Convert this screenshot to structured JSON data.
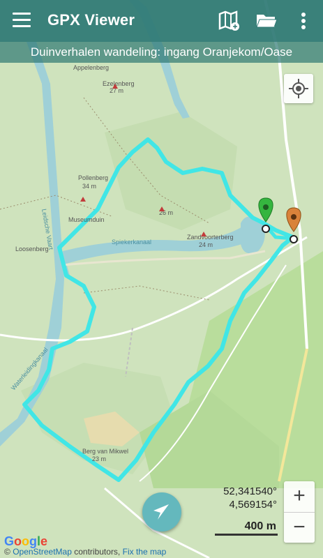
{
  "app": {
    "title": "GPX Viewer",
    "route_name": "Duinverhalen wandeling: ingang Oranjekom/Oase"
  },
  "toolbar": {
    "icons": [
      "menu-icon",
      "map-style-icon",
      "folder-icon",
      "more-vert-icon"
    ]
  },
  "map": {
    "place_labels": [
      "Appelenberg",
      "Ezelenberg",
      "27 m",
      "Pollenberg",
      "34 m",
      "Museumduin",
      "26 m",
      "Zandvoorterberg",
      "24 m",
      "Spiekerkanaal",
      "Leidsche Vaart",
      "Loosenberg",
      "Berg van Mikwel",
      "23 m",
      "Waterleidingkanaal"
    ],
    "colors": {
      "track": "#41e6e6",
      "start_marker": "#35b53f",
      "end_marker": "#d9823a",
      "water": "#9fd0d7",
      "land": "#cfe3bd"
    }
  },
  "coordinates": {
    "lat": "52,341540°",
    "lon": "4,569154°"
  },
  "zoom": {
    "in": "+",
    "out": "−"
  },
  "scale": {
    "label": "400 m"
  },
  "attribution": {
    "google": "Google",
    "text": "© OpenStreetMap contributors, Fix the map",
    "copy": "©",
    "osm": "OpenStreetMap",
    "contrib": " contributors, ",
    "fix": "Fix the map"
  }
}
